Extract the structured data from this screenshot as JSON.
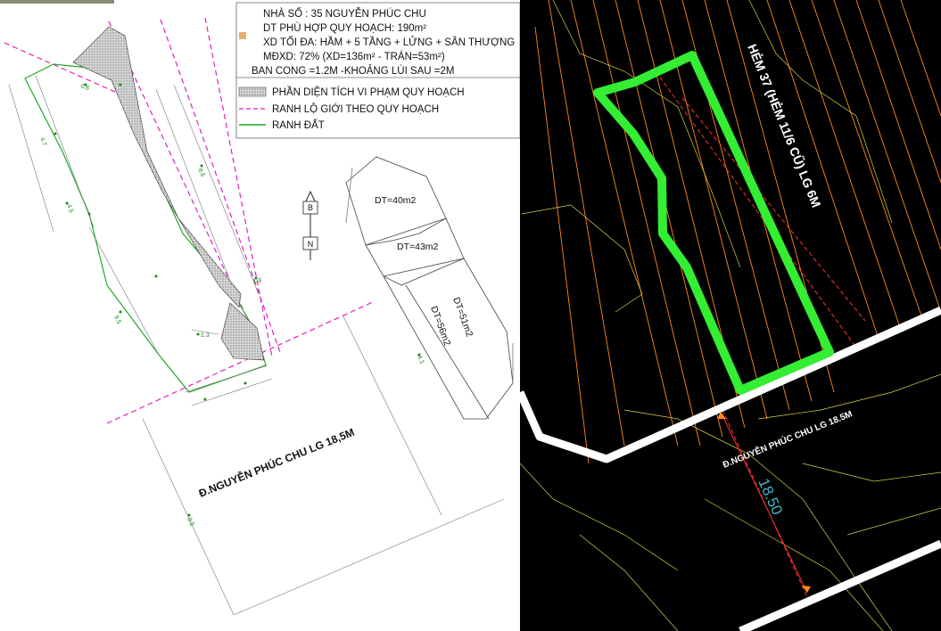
{
  "legend": {
    "lines": [
      "NHÀ SỐ : 35 NGUYỄN PHÚC CHU",
      "DT PHÙ HỢP QUY HOẠCH: 190m²",
      "XD TỐI ĐA: HẦM + 5 TẦNG + LỬNG + SÂN THƯỢNG",
      "MĐXD: 72% (XD=136m² - TRÁN=53m²)",
      "BAN CONG =1.2M -KHOẢNG LÙI SAU =2M"
    ],
    "items": [
      {
        "label": "PHẦN DIỆN TÍCH VI PHẠM QUY HOẠCH",
        "symbol": "hatch-swatch"
      },
      {
        "label": "RANH LỘ GIỚI THEO QUY HOẠCH",
        "symbol": "magenta-dashed-line",
        "color": "#e020c0"
      },
      {
        "label": "RANH ĐẤT",
        "symbol": "green-line",
        "color": "#22aa22"
      }
    ]
  },
  "north_arrow": {
    "top": "B",
    "bottom": "N"
  },
  "areas": [
    {
      "label": "DT=40m2"
    },
    {
      "label": "DT=43m2"
    },
    {
      "label": "DT=51m2"
    },
    {
      "label": "DT=56m2"
    }
  ],
  "street_left": "Đ.NGUYỄN PHÚC CHU LG 18,5M",
  "cad": {
    "alley_label": "HẺM 37 (HẺM 11/6 CŨ) LG 6M",
    "street_label": "Đ.NGUYỄN PHÚC CHU LG 18.5M",
    "width_label": "18.50"
  },
  "colors": {
    "boundary_green": "#22aa22",
    "setback_magenta": "#e020c0",
    "cad_background": "#000000",
    "cad_parcel_highlight": "#33ee33",
    "cad_lines_orange": "#ff8a1a",
    "cad_lines_yellow": "#d8d24a",
    "cad_dim_cyan": "#40b8c8"
  }
}
